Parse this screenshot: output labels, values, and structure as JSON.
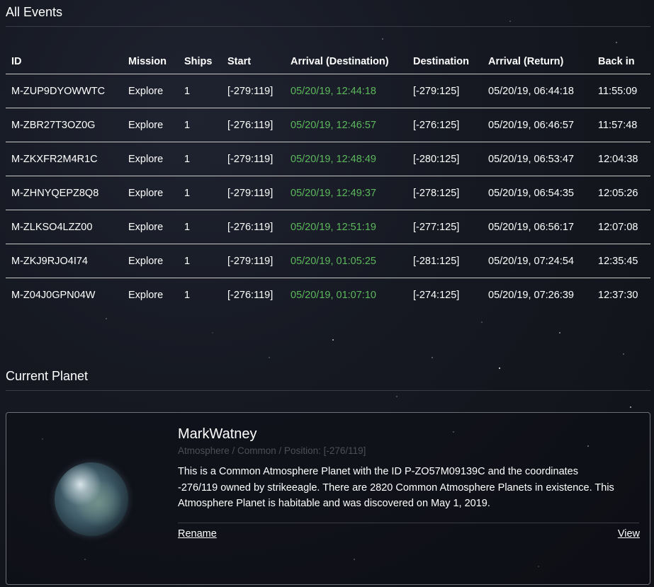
{
  "events": {
    "title": "All Events",
    "columns": [
      "ID",
      "Mission",
      "Ships",
      "Start",
      "Arrival (Destination)",
      "Destination",
      "Arrival (Return)",
      "Back in"
    ],
    "rows": [
      [
        "M-ZUP9DYOWWTC",
        "Explore",
        "1",
        "[-279:119]",
        "05/20/19, 12:44:18",
        "[-279:125]",
        "05/20/19, 06:44:18",
        "11:55:09"
      ],
      [
        "M-ZBR27T3OZ0G",
        "Explore",
        "1",
        "[-276:119]",
        "05/20/19, 12:46:57",
        "[-276:125]",
        "05/20/19, 06:46:57",
        "11:57:48"
      ],
      [
        "M-ZKXFR2M4R1C",
        "Explore",
        "1",
        "[-279:119]",
        "05/20/19, 12:48:49",
        "[-280:125]",
        "05/20/19, 06:53:47",
        "12:04:38"
      ],
      [
        "M-ZHNYQEPZ8Q8",
        "Explore",
        "1",
        "[-279:119]",
        "05/20/19, 12:49:37",
        "[-278:125]",
        "05/20/19, 06:54:35",
        "12:05:26"
      ],
      [
        "M-ZLKSO4LZZ00",
        "Explore",
        "1",
        "[-276:119]",
        "05/20/19, 12:51:19",
        "[-277:125]",
        "05/20/19, 06:56:17",
        "12:07:08"
      ],
      [
        "M-ZKJ9RJO4I74",
        "Explore",
        "1",
        "[-279:119]",
        "05/20/19, 01:05:25",
        "[-281:125]",
        "05/20/19, 07:24:54",
        "12:35:45"
      ],
      [
        "M-Z04J0GPN04W",
        "Explore",
        "1",
        "[-276:119]",
        "05/20/19, 01:07:10",
        "[-274:125]",
        "05/20/19, 07:26:39",
        "12:37:30"
      ]
    ]
  },
  "planet": {
    "section_title": "Current Planet",
    "name": "MarkWatney",
    "subtitle": "Atmosphere / Common / Position: [-276/119]",
    "description": "This is a Common Atmosphere Planet with the ID P-ZO57M09139C and the coordinates -276/119 owned by strikeeagle. There are 2820 Common Atmosphere Planets in existence. This Atmosphere Planet is habitable and was discovered on May 1, 2019.",
    "rename_label": "Rename",
    "view_label": "View",
    "image_icon": "planet-icon"
  },
  "colors": {
    "arrival_green": "#5cb85c",
    "subtitle_gray": "#4c4f57",
    "background": "#161922"
  }
}
